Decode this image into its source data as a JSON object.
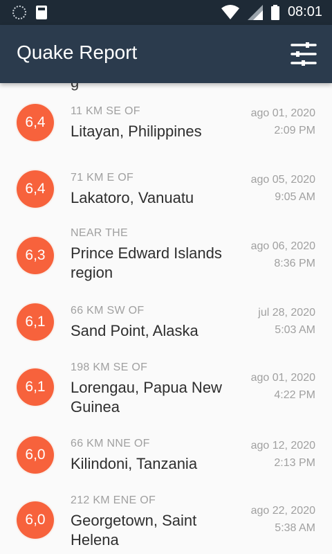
{
  "status_bar": {
    "time": "08:01"
  },
  "app_bar": {
    "title": "Quake Report"
  },
  "clipped_text": "g",
  "quakes": [
    {
      "mag": "6,4",
      "offset": "11 KM SE OF",
      "place": "Litayan, Philippines",
      "date": "ago 01, 2020",
      "time": "2:09 PM"
    },
    {
      "mag": "6,4",
      "offset": "71 KM E OF",
      "place": "Lakatoro, Vanuatu",
      "date": "ago 05, 2020",
      "time": "9:05 AM"
    },
    {
      "mag": "6,3",
      "offset": "NEAR THE",
      "place": "Prince Edward Islands region",
      "date": "ago 06, 2020",
      "time": "8:36 PM"
    },
    {
      "mag": "6,1",
      "offset": "66 KM SW OF",
      "place": "Sand Point, Alaska",
      "date": "jul 28, 2020",
      "time": "5:03 AM"
    },
    {
      "mag": "6,1",
      "offset": "198 KM SE OF",
      "place": "Lorengau, Papua New Guinea",
      "date": "ago 01, 2020",
      "time": "4:22 PM"
    },
    {
      "mag": "6,0",
      "offset": "66 KM NNE OF",
      "place": "Kilindoni, Tanzania",
      "date": "ago 12, 2020",
      "time": "2:13 PM"
    },
    {
      "mag": "6,0",
      "offset": "212 KM ENE OF",
      "place": "Georgetown, Saint Helena",
      "date": "ago 22, 2020",
      "time": "5:38 AM"
    }
  ],
  "colors": {
    "status_bar": "#1e2a36",
    "app_bar": "#2b3b4d",
    "magnitude_circle": "#f7623c",
    "secondary_text": "#a0a0a0",
    "primary_text": "#2e2e2e"
  },
  "icons": {
    "status_left": [
      "notification-dots-icon",
      "sd-card-icon"
    ],
    "status_right": [
      "wifi-icon",
      "signal-icon",
      "battery-icon"
    ],
    "app_bar_action": "filter-settings-icon"
  }
}
